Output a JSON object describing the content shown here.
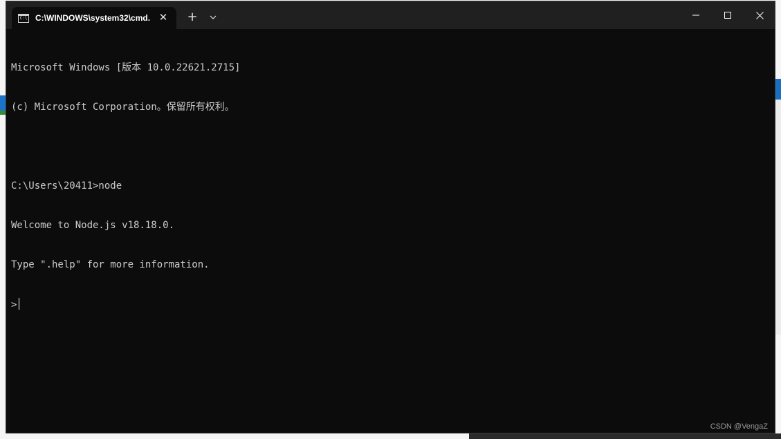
{
  "window": {
    "tab_title": "C:\\WINDOWS\\system32\\cmd.",
    "tab_icon": "cmd-icon",
    "tab_icon_text": "C:\\",
    "close_tab_glyph": "✕",
    "new_tab_glyph": "+",
    "dropdown_icon": "chevron-down-icon",
    "minimize_icon": "minimize-icon",
    "maximize_icon": "maximize-icon",
    "close_icon": "close-icon"
  },
  "console": {
    "lines": [
      "Microsoft Windows [版本 10.0.22621.2715]",
      "(c) Microsoft Corporation。保留所有权利。",
      "",
      "C:\\Users\\20411>node",
      "Welcome to Node.js v18.18.0.",
      "Type \".help\" for more information.",
      ">"
    ]
  },
  "watermark": "CSDN @VengaZ",
  "colors": {
    "titlebar": "#202020",
    "console_bg": "#0c0c0c",
    "console_text": "#cccccc"
  }
}
